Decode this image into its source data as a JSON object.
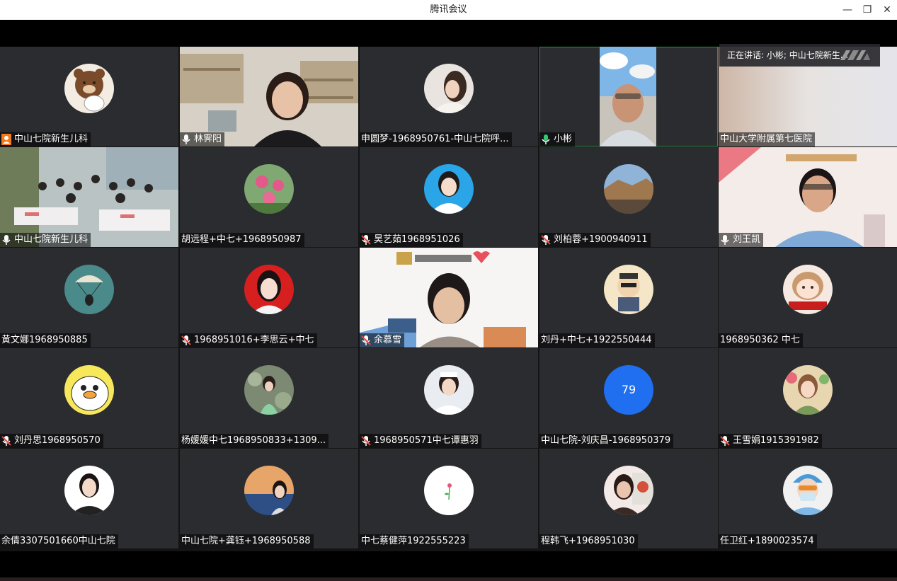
{
  "window": {
    "title": "腾讯会议",
    "minimize": "—",
    "restore": "❐",
    "close": "✕"
  },
  "speaking_banner": "正在讲话: 小彬; 中山七院新生...",
  "participants": [
    {
      "name": "中山七院新生儿科",
      "icon": "person-orange-icon"
    },
    {
      "name": "林霁阳",
      "icon": "mic-on-icon"
    },
    {
      "name": "申圆梦-1968950761-中山七院呼...",
      "icon": "none"
    },
    {
      "name": "小彬",
      "icon": "mic-active-icon"
    },
    {
      "name": "中山大学附属第七医院",
      "icon": "none"
    },
    {
      "name": "中山七院新生儿科",
      "icon": "mic-on-icon"
    },
    {
      "name": "胡远程+中七+1968950987",
      "icon": "none"
    },
    {
      "name": "昊艺茹1968951026",
      "icon": "mic-muted-icon"
    },
    {
      "name": "刘柏蓉+1900940911",
      "icon": "mic-muted-icon"
    },
    {
      "name": "刘王凯",
      "icon": "mic-on-icon"
    },
    {
      "name": "黄文娜1968950885",
      "icon": "none"
    },
    {
      "name": "1968951016+李思云+中七",
      "icon": "mic-muted-icon"
    },
    {
      "name": "余慕雪",
      "icon": "mic-muted-icon"
    },
    {
      "name": "刘丹+中七+1922550444",
      "icon": "none"
    },
    {
      "name": "1968950362 中七",
      "icon": "none"
    },
    {
      "name": "刘丹思1968950570",
      "icon": "mic-muted-icon"
    },
    {
      "name": "杨媛媛中七1968950833+1309...",
      "icon": "none"
    },
    {
      "name": "1968950571中七谭惠羽",
      "icon": "mic-muted-icon"
    },
    {
      "name": "中山七院-刘庆昌-1968950379",
      "icon": "none",
      "avatar_text": "79"
    },
    {
      "name": "王雪娟1915391982",
      "icon": "mic-muted-icon"
    },
    {
      "name": "余倩3307501660中山七院",
      "icon": "none"
    },
    {
      "name": "中山七院+龚钰+1968950588",
      "icon": "none"
    },
    {
      "name": "中七蔡健萍1922555223",
      "icon": "none"
    },
    {
      "name": "程韩飞+1968951030",
      "icon": "none"
    },
    {
      "name": "任卫红+1890023574",
      "icon": "none"
    }
  ],
  "colors": {
    "tile_bg": "#2b2c30",
    "active_border": "#2f8f4e",
    "mic_active": "#2ecc71",
    "avatar_number_bg": "#1f6ff0"
  }
}
